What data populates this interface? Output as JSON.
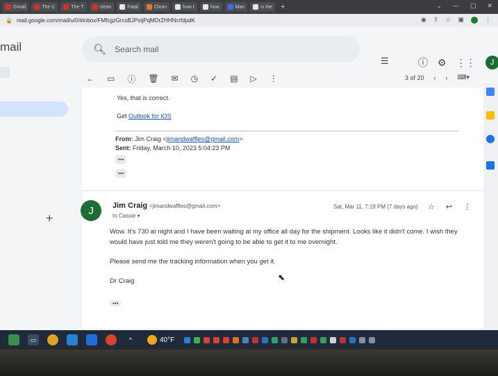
{
  "browser": {
    "tabs": [
      "Gmail",
      "The C",
      "The T",
      "clean",
      "Fatal",
      "Clean",
      "how t",
      "how",
      "Man",
      "is the"
    ],
    "url": "mail.google.com/mail/u/0/#inbox/FMfcgzGrcsBJPstjPqMDrZHHNcrfdpdK",
    "new_tab": "+",
    "window_controls": [
      "⌄",
      "—",
      "▢",
      "✕"
    ]
  },
  "gmail": {
    "logo": "mail",
    "search_placeholder": "Search mail",
    "avatar_letter": "J",
    "pagination": "3 of 20"
  },
  "quoted_message": {
    "line1": "Yes, that is correct.",
    "get_prefix": "Get ",
    "get_link": "Outlook for iOS",
    "from_label": "From:",
    "from_value": "Jim Craig <",
    "from_email": "jimandwaffles@gmail.com",
    "from_close": ">",
    "sent_label": "Sent:",
    "sent_value": "Friday, March 10, 2023 5:04:23 PM",
    "dots": "•••"
  },
  "message": {
    "avatar_letter": "J",
    "sender_name": "Jim Craig",
    "sender_email": "<jimandwaffles@gmail.com>",
    "to": "to Cassie ▾",
    "date": "Sat, Mar 11, 7:19 PM (7 days ago)",
    "para1": "Wow. It's 730 at night and I have been waiting at my office all day for the shipment. Looks like it didn't come. I wish they would have just told me they weren't going to be able to get it to me overnight.",
    "para2": "Please send me the tracking information when you get it.",
    "signature": "Dr Craig",
    "dots": "•••"
  },
  "taskbar": {
    "temperature": "40°F"
  }
}
